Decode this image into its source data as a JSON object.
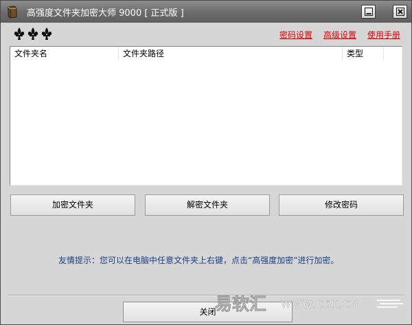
{
  "window": {
    "title": "高强度文件夹加密大师 9000 [ 正式版 ]"
  },
  "top_links": {
    "password_settings": "密码设置",
    "advanced_settings": "高级设置",
    "manual": "使用手册"
  },
  "list": {
    "columns": [
      "文件夹名",
      "文件夹路径",
      "类型"
    ],
    "rows": []
  },
  "buttons": {
    "encrypt": "加密文件夹",
    "decrypt": "解密文件夹",
    "change_password": "修改密码",
    "close": "关闭"
  },
  "tip": "友情提示：您可以在电脑中任意文件夹上右键，点击“高强度加密”进行加密。",
  "watermark": {
    "brand": "易软汇",
    "url": "WWW.C6K.CN"
  },
  "icons": {
    "app": "book-icon",
    "logo": "fleur-de-lis-icon",
    "minimize": "minimize-icon",
    "close": "close-icon"
  },
  "colors": {
    "link": "#e00000",
    "tip": "#1a3f86",
    "titlebar": "#6b6b6b"
  }
}
